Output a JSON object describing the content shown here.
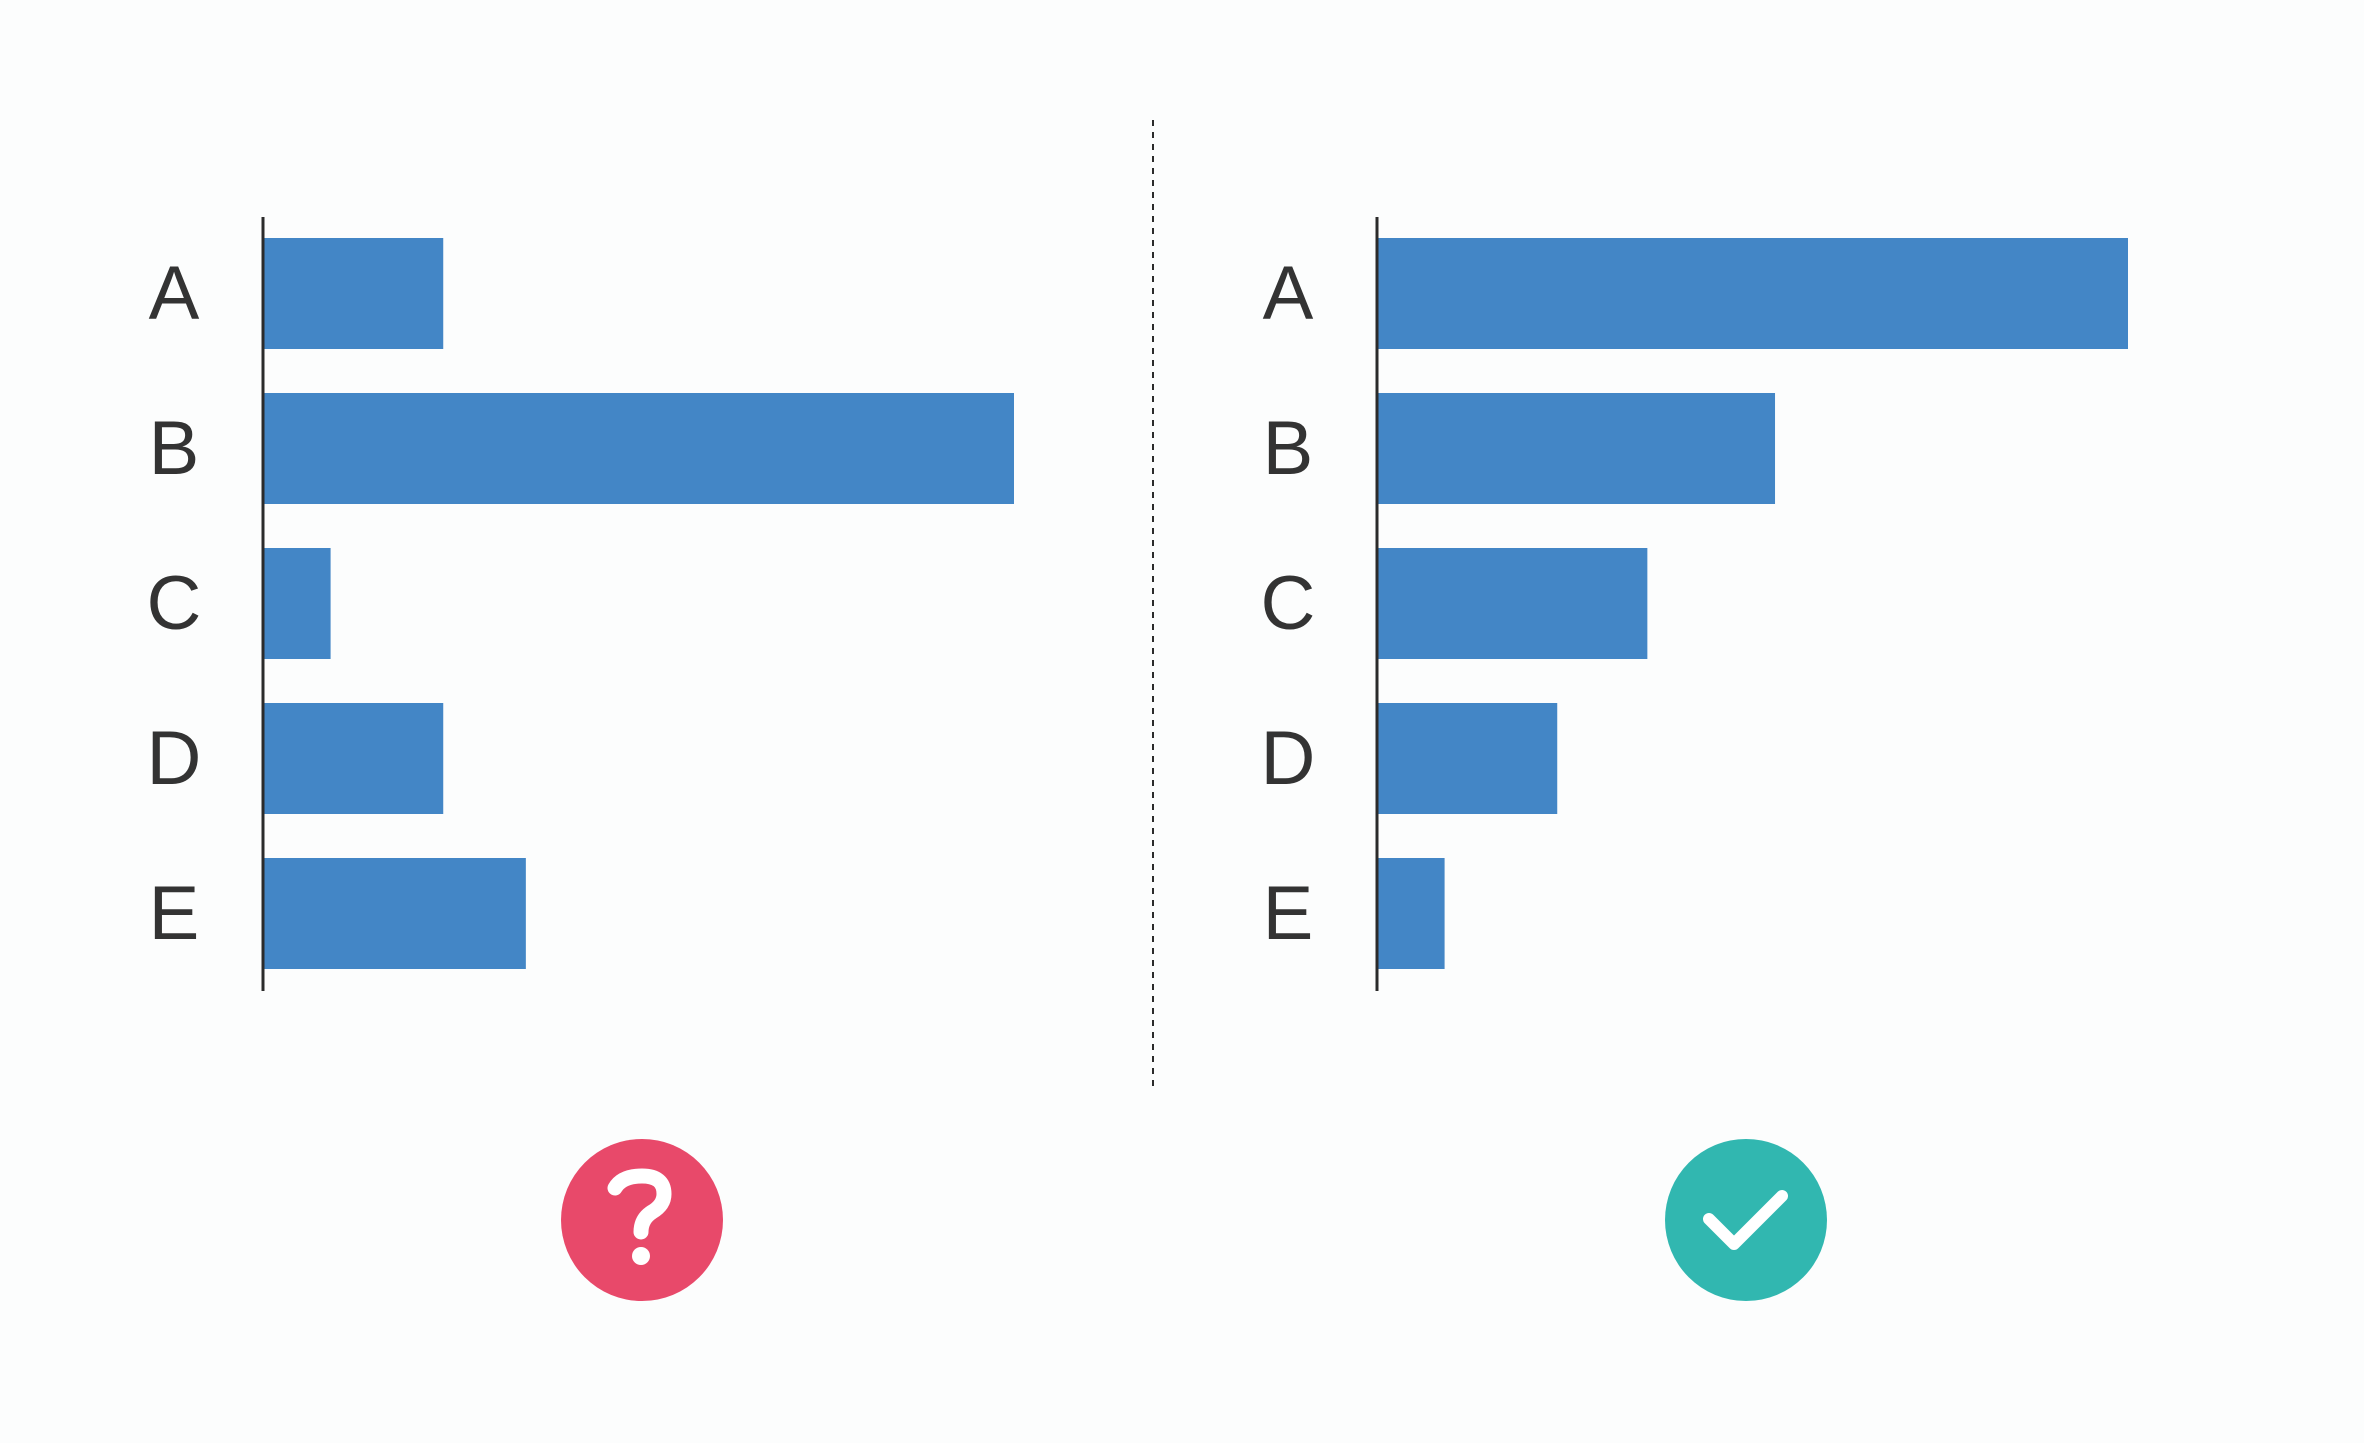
{
  "colors": {
    "background": "#fcfdfd",
    "bar": "#4386c6",
    "axis": "#2b2b2b",
    "label": "#333333",
    "bad_badge": "#e8496a",
    "good_badge": "#31b7b0",
    "icon_glyph": "#ffffff"
  },
  "chart_data": [
    {
      "type": "bar",
      "orientation": "horizontal",
      "sorted": false,
      "categories": [
        "A",
        "B",
        "C",
        "D",
        "E"
      ],
      "values": [
        24,
        100,
        9,
        24,
        35
      ],
      "xlim": [
        0,
        100
      ],
      "grid": false,
      "badge": {
        "icon": "question-mark-icon",
        "meaning": "bad"
      }
    },
    {
      "type": "bar",
      "orientation": "horizontal",
      "sorted": true,
      "categories": [
        "A",
        "B",
        "C",
        "D",
        "E"
      ],
      "values": [
        100,
        53,
        36,
        24,
        9
      ],
      "xlim": [
        0,
        100
      ],
      "grid": false,
      "badge": {
        "icon": "checkmark-icon",
        "meaning": "good"
      }
    }
  ]
}
